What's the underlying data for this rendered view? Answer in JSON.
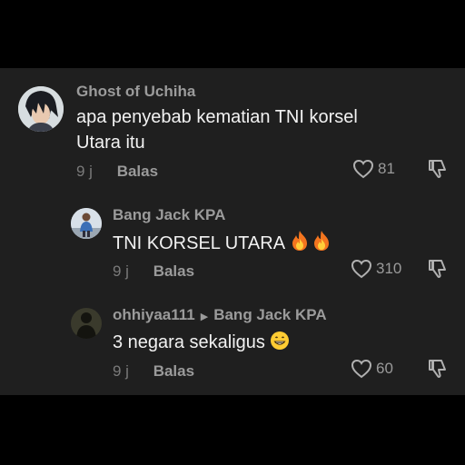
{
  "comments": [
    {
      "username": "Ghost of Uchiha",
      "text": "apa penyebab kematian TNI korsel Utara itu",
      "time": "9 j",
      "reply_label": "Balas",
      "likes": "81",
      "avatar_icon": "anime-character-avatar"
    },
    {
      "username": "Bang Jack KPA",
      "text": "TNI KORSEL UTARA",
      "emojis": [
        "fire",
        "fire"
      ],
      "time": "9 j",
      "reply_label": "Balas",
      "likes": "310",
      "avatar_icon": "person-photo-avatar"
    },
    {
      "username": "ohhiyaa111",
      "reply_to": "Bang Jack KPA",
      "text": "3 negara sekaligus",
      "emojis": [
        "grinning-face"
      ],
      "time": "9 j",
      "reply_label": "Balas",
      "likes": "60",
      "avatar_icon": "silhouette-avatar"
    }
  ],
  "colors": {
    "background": "#000000",
    "panel": "#1f1f1f",
    "username": "#9b9b9b",
    "comment_text": "#f2f2f2",
    "meta": "#8a8a8a"
  }
}
